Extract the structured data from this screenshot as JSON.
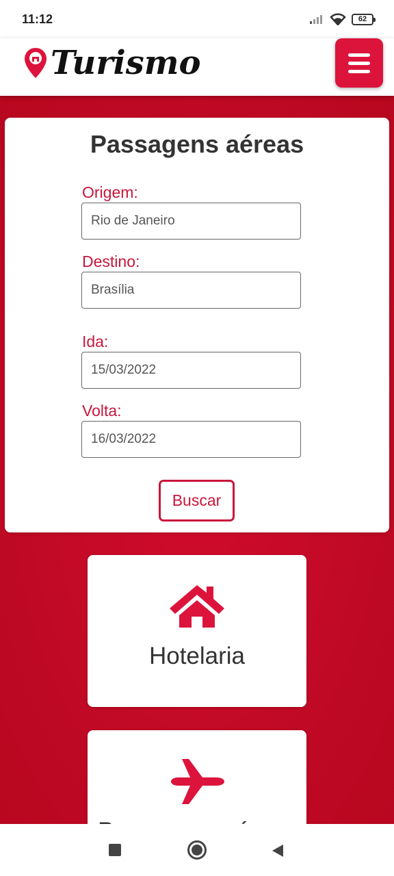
{
  "status_bar": {
    "time": "11:12",
    "battery": "62"
  },
  "header": {
    "logo_text": "Turismo"
  },
  "search_form": {
    "title": "Passagens aéreas",
    "origin": {
      "label": "Origem:",
      "value": "Rio de Janeiro"
    },
    "destination": {
      "label": "Destino:",
      "value": "Brasília"
    },
    "departure": {
      "label": "Ida:",
      "value": "15/03/2022"
    },
    "return": {
      "label": "Volta:",
      "value": "16/03/2022"
    },
    "search_label": "Buscar"
  },
  "services": [
    {
      "label": "Hotelaria",
      "icon": "house-icon"
    },
    {
      "label": "Passagens aéreas",
      "icon": "airplane-icon"
    }
  ],
  "colors": {
    "brand": "#dc143c",
    "background": "#c20a26",
    "label": "#c8163b"
  }
}
